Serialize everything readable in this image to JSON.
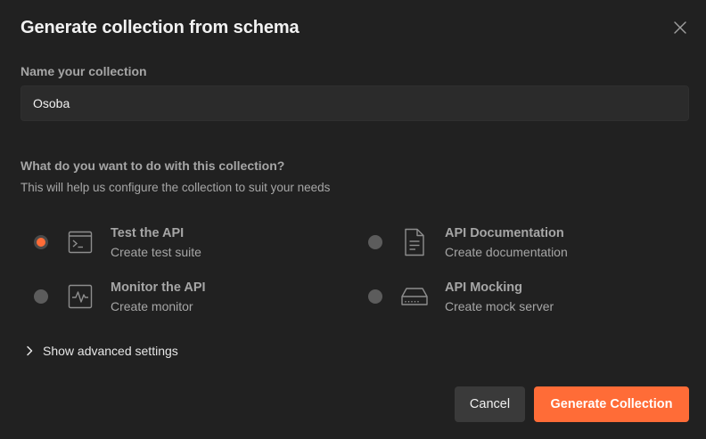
{
  "dialog": {
    "title": "Generate collection from schema",
    "close_icon": "close-icon"
  },
  "name_field": {
    "label": "Name your collection",
    "value": "Osoba"
  },
  "purpose": {
    "question": "What do you want to do with this collection?",
    "hint": "This will help us configure the collection to suit your needs",
    "options": [
      {
        "title": "Test the API",
        "subtitle": "Create test suite",
        "icon": "terminal-icon",
        "selected": true
      },
      {
        "title": "API Documentation",
        "subtitle": "Create documentation",
        "icon": "document-icon",
        "selected": false
      },
      {
        "title": "Monitor the API",
        "subtitle": "Create monitor",
        "icon": "activity-monitor-icon",
        "selected": false
      },
      {
        "title": "API Mocking",
        "subtitle": "Create mock server",
        "icon": "server-icon",
        "selected": false
      }
    ]
  },
  "advanced": {
    "label": "Show advanced settings",
    "icon": "chevron-right-icon"
  },
  "actions": {
    "cancel_label": "Cancel",
    "generate_label": "Generate Collection"
  },
  "colors": {
    "background": "#212121",
    "accent": "#ff6c37",
    "input_background": "#2b2b2b",
    "muted_text": "#a6a6a6"
  }
}
